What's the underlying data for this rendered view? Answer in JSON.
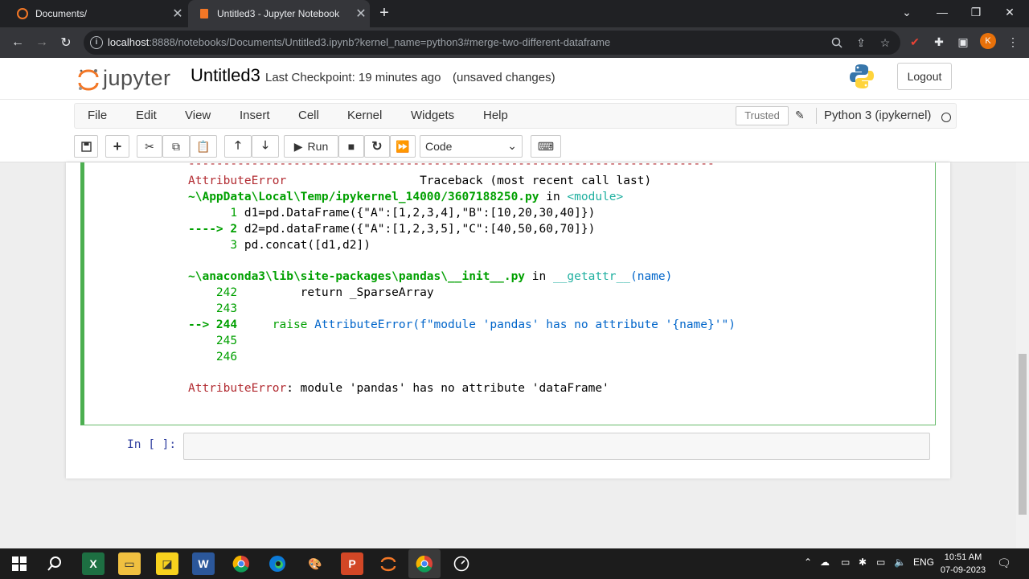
{
  "browser": {
    "tabs": [
      {
        "title": "Documents/",
        "active": false
      },
      {
        "title": "Untitled3 - Jupyter Notebook",
        "active": true
      }
    ],
    "url_host": "localhost",
    "url_rest": ":8888/notebooks/Documents/Untitled3.ipynb?kernel_name=python3#merge-two-different-dataframe",
    "profile_initial": "K",
    "icons": [
      "back-arrow-icon",
      "forward-arrow-icon",
      "reload-icon",
      "zoom-icon",
      "share-icon",
      "bookmark-star-icon",
      "extensions-puzzle-icon",
      "side-panel-icon"
    ]
  },
  "jupyter": {
    "logo_text": "jupyter",
    "notebook_name": "Untitled3",
    "checkpoint": "Last Checkpoint: 19 minutes ago",
    "save_status": "(unsaved changes)",
    "logout_label": "Logout",
    "menu": [
      "File",
      "Edit",
      "View",
      "Insert",
      "Cell",
      "Kernel",
      "Widgets",
      "Help"
    ],
    "trusted_label": "Trusted",
    "kernel_name": "Python 3 (ipykernel)",
    "run_label": "Run",
    "cell_type": "Code"
  },
  "output": {
    "dashes": "---------------------------------------------------------------------------",
    "err_name": "AttributeError",
    "traceback_header": "Traceback (most recent call last)",
    "frame1_path": "~\\AppData\\Local\\Temp/ipykernel_14000/3607188250.py",
    "frame1_in": " in ",
    "frame1_module": "<module>",
    "frame1_l1_num": "      1 ",
    "frame1_l1_code": "d1=pd.DataFrame({\"A\":[1,2,3,4],\"B\":[10,20,30,40]})",
    "frame1_l2_arrow": "----> 2 ",
    "frame1_l2_code": "d2=pd.dataFrame({\"A\":[1,2,3,5],\"C\":[40,50,60,70]})",
    "frame1_l3_num": "      3 ",
    "frame1_l3_code": "pd.concat([d1,d2])",
    "frame2_path": "~\\anaconda3\\lib\\site-packages\\pandas\\__init__.py",
    "frame2_in": " in ",
    "frame2_func": "__getattr__",
    "frame2_arg": "(name)",
    "frame2_l242_num": "    242 ",
    "frame2_l242_code": "        return _SparseArray",
    "frame2_l243_num": "    243 ",
    "frame2_l244_arrow": "--> 244 ",
    "frame2_l244_code_a": "    raise ",
    "frame2_l244_code_b": "AttributeError(f\"module 'pandas' has no attribute '{name}'\")",
    "frame2_l245_num": "    245 ",
    "frame2_l246_num": "    246 ",
    "final_err_name": "AttributeError",
    "final_err_msg": ": module 'pandas' has no attribute 'dataFrame'",
    "next_prompt": "In [ ]:"
  },
  "taskbar": {
    "apps": [
      "windows-start-icon",
      "search-icon",
      "excel-icon",
      "file-explorer-icon",
      "sticky-notes-icon",
      "word-icon",
      "chrome-icon",
      "edge-icon",
      "paint-icon",
      "powerpoint-icon",
      "jupyter-app-icon",
      "chrome-active-icon",
      "speedometer-icon"
    ],
    "lang": "ENG",
    "time": "10:51 AM",
    "date": "07-09-2023"
  },
  "colors": {
    "accent_green": "#4caf50",
    "error_red": "#b22b31",
    "jupyter_orange": "#f37726",
    "chrome_dark": "#202124"
  }
}
